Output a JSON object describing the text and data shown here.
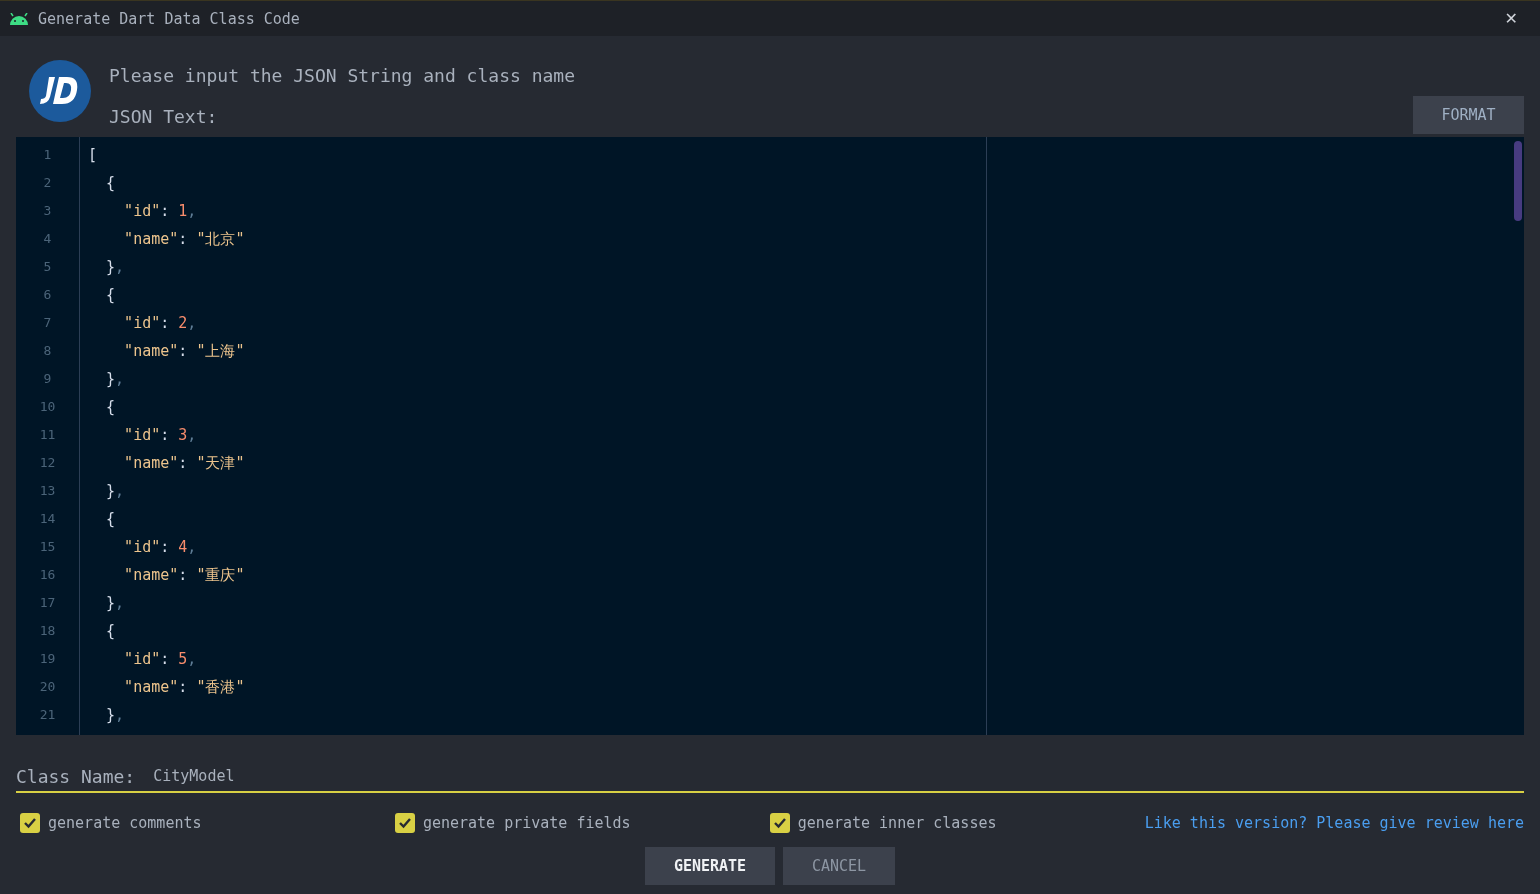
{
  "window": {
    "title": "Generate Dart Data Class Code",
    "close": "✕"
  },
  "header": {
    "prompt": "Please input the JSON String and class name",
    "json_label": "JSON Text:",
    "format_button": "FORMAT"
  },
  "editor": {
    "lines": [
      {
        "number": "1",
        "tokens": [
          {
            "kind": "punct",
            "text": "["
          }
        ]
      },
      {
        "number": "2",
        "tokens": [
          {
            "kind": "punct",
            "text": "  {"
          }
        ]
      },
      {
        "number": "3",
        "tokens": [
          {
            "kind": "string",
            "text": "    \"id\""
          },
          {
            "kind": "punct",
            "text": ": "
          },
          {
            "kind": "number",
            "text": "1"
          },
          {
            "kind": "comma",
            "text": ","
          }
        ]
      },
      {
        "number": "4",
        "tokens": [
          {
            "kind": "string",
            "text": "    \"name\""
          },
          {
            "kind": "punct",
            "text": ": "
          },
          {
            "kind": "string",
            "text": "\"北京\""
          }
        ]
      },
      {
        "number": "5",
        "tokens": [
          {
            "kind": "punct",
            "text": "  }"
          },
          {
            "kind": "comma",
            "text": ","
          }
        ]
      },
      {
        "number": "6",
        "tokens": [
          {
            "kind": "punct",
            "text": "  {"
          }
        ]
      },
      {
        "number": "7",
        "tokens": [
          {
            "kind": "string",
            "text": "    \"id\""
          },
          {
            "kind": "punct",
            "text": ": "
          },
          {
            "kind": "number",
            "text": "2"
          },
          {
            "kind": "comma",
            "text": ","
          }
        ]
      },
      {
        "number": "8",
        "tokens": [
          {
            "kind": "string",
            "text": "    \"name\""
          },
          {
            "kind": "punct",
            "text": ": "
          },
          {
            "kind": "string",
            "text": "\"上海\""
          }
        ]
      },
      {
        "number": "9",
        "tokens": [
          {
            "kind": "punct",
            "text": "  }"
          },
          {
            "kind": "comma",
            "text": ","
          }
        ]
      },
      {
        "number": "10",
        "tokens": [
          {
            "kind": "punct",
            "text": "  {"
          }
        ]
      },
      {
        "number": "11",
        "tokens": [
          {
            "kind": "string",
            "text": "    \"id\""
          },
          {
            "kind": "punct",
            "text": ": "
          },
          {
            "kind": "number",
            "text": "3"
          },
          {
            "kind": "comma",
            "text": ","
          }
        ]
      },
      {
        "number": "12",
        "tokens": [
          {
            "kind": "string",
            "text": "    \"name\""
          },
          {
            "kind": "punct",
            "text": ": "
          },
          {
            "kind": "string",
            "text": "\"天津\""
          }
        ]
      },
      {
        "number": "13",
        "tokens": [
          {
            "kind": "punct",
            "text": "  }"
          },
          {
            "kind": "comma",
            "text": ","
          }
        ]
      },
      {
        "number": "14",
        "tokens": [
          {
            "kind": "punct",
            "text": "  {"
          }
        ]
      },
      {
        "number": "15",
        "tokens": [
          {
            "kind": "string",
            "text": "    \"id\""
          },
          {
            "kind": "punct",
            "text": ": "
          },
          {
            "kind": "number",
            "text": "4"
          },
          {
            "kind": "comma",
            "text": ","
          }
        ]
      },
      {
        "number": "16",
        "tokens": [
          {
            "kind": "string",
            "text": "    \"name\""
          },
          {
            "kind": "punct",
            "text": ": "
          },
          {
            "kind": "string",
            "text": "\"重庆\""
          }
        ]
      },
      {
        "number": "17",
        "tokens": [
          {
            "kind": "punct",
            "text": "  }"
          },
          {
            "kind": "comma",
            "text": ","
          }
        ]
      },
      {
        "number": "18",
        "tokens": [
          {
            "kind": "punct",
            "text": "  {"
          }
        ]
      },
      {
        "number": "19",
        "tokens": [
          {
            "kind": "string",
            "text": "    \"id\""
          },
          {
            "kind": "punct",
            "text": ": "
          },
          {
            "kind": "number",
            "text": "5"
          },
          {
            "kind": "comma",
            "text": ","
          }
        ]
      },
      {
        "number": "20",
        "tokens": [
          {
            "kind": "string",
            "text": "    \"name\""
          },
          {
            "kind": "punct",
            "text": ": "
          },
          {
            "kind": "string",
            "text": "\"香港\""
          }
        ]
      },
      {
        "number": "21",
        "tokens": [
          {
            "kind": "punct",
            "text": "  }"
          },
          {
            "kind": "comma",
            "text": ","
          }
        ]
      }
    ]
  },
  "class_name": {
    "label": "Class Name:",
    "value": "CityModel"
  },
  "options": [
    {
      "label": "generate comments",
      "checked": true
    },
    {
      "label": "generate private fields",
      "checked": true
    },
    {
      "label": "generate inner classes",
      "checked": true
    }
  ],
  "review_link": "Like this version? Please give review here",
  "buttons": [
    {
      "label": "GENERATE",
      "kind": "primary"
    },
    {
      "label": "CANCEL",
      "kind": "secondary"
    }
  ]
}
